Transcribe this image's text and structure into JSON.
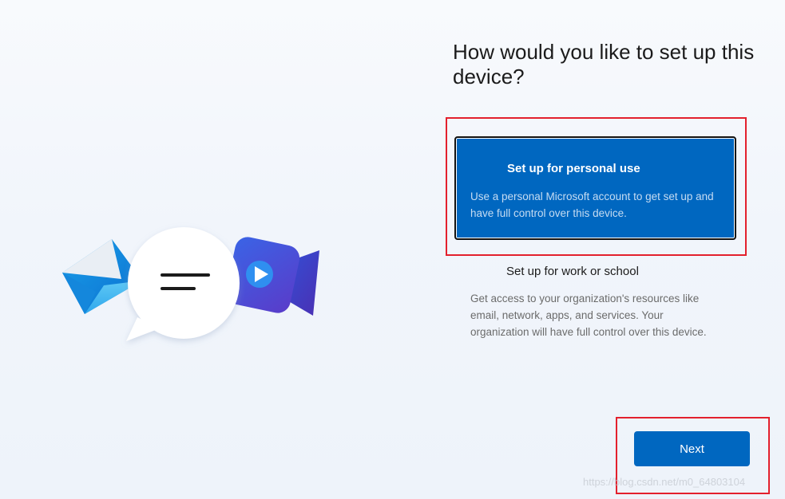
{
  "page": {
    "title": "How would you like to set up this device?"
  },
  "options": [
    {
      "title": "Set up for personal use",
      "description": "Use a personal Microsoft account to get set up and have full control over this device.",
      "selected": true
    },
    {
      "title": "Set up for work or school",
      "description": "Get access to your organization's resources like email, network, apps, and services. Your organization will have full control over this device.",
      "selected": false
    }
  ],
  "footer": {
    "next_label": "Next"
  },
  "watermark": "https://blog.csdn.net/m0_64803104",
  "colors": {
    "accent": "#0067c0",
    "highlight_border": "#e3202d",
    "selected_desc": "#c6dcf2"
  },
  "icons": {
    "mail": "mail-envelope-icon",
    "chat": "chat-bubble-icon",
    "video": "video-camera-icon"
  }
}
